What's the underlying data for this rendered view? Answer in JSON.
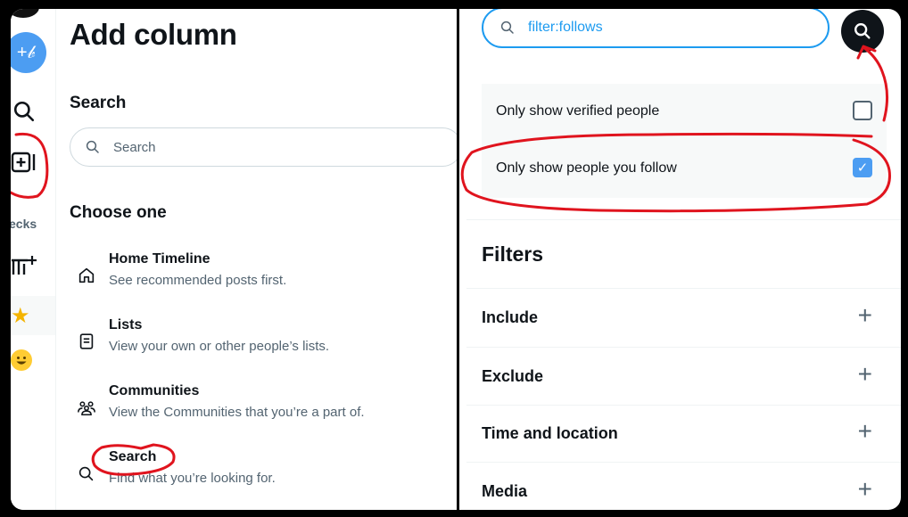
{
  "left": {
    "title": "Add column",
    "search_section_title": "Search",
    "search_placeholder": "Search",
    "choose_title": "Choose one",
    "rail_decks_label": "ecks",
    "options": [
      {
        "title": "Home Timeline",
        "desc": "See recommended posts first.",
        "icon": "home-icon"
      },
      {
        "title": "Lists",
        "desc": "View your own or other people’s lists.",
        "icon": "list-icon"
      },
      {
        "title": "Communities",
        "desc": "View the Communities that you’re a part of.",
        "icon": "communities-icon"
      },
      {
        "title": "Search",
        "desc": "Find what you’re looking for.",
        "icon": "search-icon"
      }
    ]
  },
  "right": {
    "search_value": "filter:follows",
    "checks": [
      {
        "label": "Only show verified people",
        "checked": false
      },
      {
        "label": "Only show people you follow",
        "checked": true
      }
    ],
    "filters_title": "Filters",
    "filters": [
      "Include",
      "Exclude",
      "Time and location",
      "Media"
    ]
  },
  "colors": {
    "accent": "#1d9bf0",
    "compose_button": "#4c9df2",
    "annotation": "#e0141e",
    "text_secondary": "#536471"
  }
}
